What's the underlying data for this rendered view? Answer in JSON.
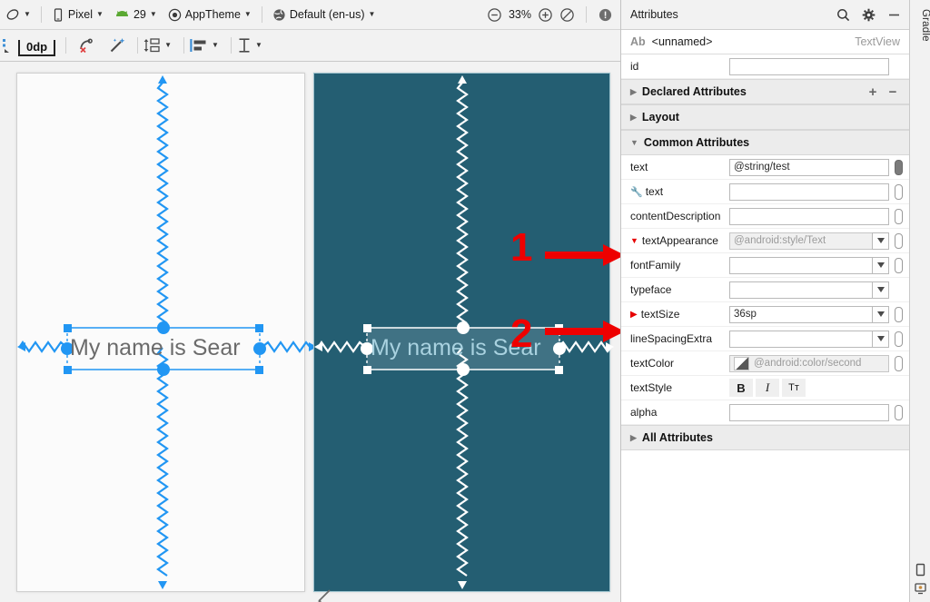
{
  "toolbar_main": {
    "items": [
      {
        "name": "design-surface-mode",
        "icon": "rotate-device-icon",
        "label": "",
        "caret": true
      },
      {
        "name": "device-selector",
        "icon": "phone-icon",
        "label": "Pixel",
        "caret": true
      },
      {
        "name": "api-level-selector",
        "icon": "android-api-icon",
        "label": "29",
        "caret": true
      },
      {
        "name": "theme-selector",
        "icon": "theme-circle-icon",
        "label": "AppTheme",
        "caret": true
      },
      {
        "name": "locale-selector",
        "icon": "globe-icon",
        "label": "Default (en-us)",
        "caret": true
      }
    ],
    "zoom": {
      "zoom_out_label": "⊖",
      "zoom_level": "33%",
      "zoom_in_label": "⊕",
      "zoom_fit_label": "⊘"
    },
    "warnings_icon": "warning-exclamation-icon"
  },
  "toolbar_constraints": {
    "margin_value": "0dp",
    "buttons": [
      {
        "name": "clear-constraints-button",
        "icon": "clear-constraints-icon"
      },
      {
        "name": "infer-constraints-button",
        "icon": "magic-wand-icon"
      },
      {
        "name": "pack-button",
        "icon": "pack-icon",
        "caret": true
      },
      {
        "name": "align-button",
        "icon": "align-icon",
        "caret": true
      },
      {
        "name": "guideline-button",
        "icon": "guideline-icon",
        "caret": true
      }
    ]
  },
  "canvas": {
    "devices": [
      {
        "name": "device-preview-light",
        "theme": "light",
        "background": "#fbfbfb",
        "widget_text": "My name is Sear"
      },
      {
        "name": "device-preview-dark",
        "theme": "dark",
        "background": "#245e72",
        "widget_text": "My name is Sear"
      }
    ],
    "annotations": [
      {
        "name": "annotation-1",
        "label": "1",
        "color": "#ee0000",
        "points_to": "textAppearance"
      },
      {
        "name": "annotation-2",
        "label": "2",
        "color": "#ee0000",
        "points_to": "textSize"
      }
    ],
    "edit_icon": "pencil-edit-icon"
  },
  "attributes_panel": {
    "title": "Attributes",
    "header_buttons": [
      {
        "name": "search-icon",
        "glyph": "search"
      },
      {
        "name": "gear-icon",
        "glyph": "gear"
      },
      {
        "name": "minimize-icon",
        "glyph": "minus"
      }
    ],
    "component": {
      "ab_mark": "Ab",
      "name": "<unnamed>",
      "type": "TextView"
    },
    "id_row": {
      "label": "id",
      "value": "",
      "placeholder": ""
    },
    "sections": [
      {
        "name": "declared-attributes-section",
        "label": "Declared Attributes",
        "expanded": false,
        "add": "+",
        "remove": "−"
      },
      {
        "name": "layout-section",
        "label": "Layout",
        "expanded": false
      },
      {
        "name": "common-attributes-section",
        "label": "Common Attributes",
        "expanded": true
      }
    ],
    "common_attributes": [
      {
        "name": "text",
        "label": "text",
        "value": "@string/test",
        "kind": "text",
        "pill": "filled",
        "disabled": false,
        "wrench": false,
        "marker": ""
      },
      {
        "name": "text-resolved",
        "label": "text",
        "value": "",
        "kind": "text",
        "pill": "empty",
        "disabled": false,
        "wrench": true,
        "marker": ""
      },
      {
        "name": "contentDescription",
        "label": "contentDescription",
        "value": "",
        "kind": "text",
        "pill": "empty",
        "disabled": false,
        "wrench": false,
        "marker": ""
      },
      {
        "name": "textAppearance",
        "label": "textAppearance",
        "value": "@android:style/Text",
        "kind": "combo",
        "pill": "empty",
        "disabled": true,
        "wrench": false,
        "marker": "red-expand"
      },
      {
        "name": "fontFamily",
        "label": "fontFamily",
        "value": "",
        "kind": "combo",
        "pill": "empty",
        "disabled": false,
        "wrench": false,
        "marker": ""
      },
      {
        "name": "typeface",
        "label": "typeface",
        "value": "",
        "kind": "combo",
        "pill": "hidden",
        "disabled": false,
        "wrench": false,
        "marker": ""
      },
      {
        "name": "textSize",
        "label": "textSize",
        "value": "36sp",
        "kind": "combo",
        "pill": "empty",
        "disabled": false,
        "wrench": false,
        "marker": "red"
      },
      {
        "name": "lineSpacingExtra",
        "label": "lineSpacingExtra",
        "value": "",
        "kind": "combo",
        "pill": "empty",
        "disabled": false,
        "wrench": false,
        "marker": ""
      },
      {
        "name": "textColor",
        "label": "textColor",
        "value": "@android:color/second",
        "kind": "color",
        "pill": "empty",
        "disabled": true,
        "wrench": false,
        "marker": ""
      },
      {
        "name": "textStyle",
        "label": "textStyle",
        "value": "",
        "kind": "style",
        "pill": "hidden",
        "disabled": false,
        "wrench": false,
        "marker": ""
      },
      {
        "name": "alpha",
        "label": "alpha",
        "value": "",
        "kind": "text",
        "pill": "empty",
        "disabled": false,
        "wrench": false,
        "marker": ""
      }
    ],
    "text_style_buttons": [
      {
        "name": "bold-button",
        "label": "B"
      },
      {
        "name": "italic-button",
        "label": "I"
      },
      {
        "name": "all-caps-button",
        "label": "Tт"
      }
    ],
    "all_attributes_section": {
      "name": "all-attributes-section",
      "label": "All Attributes",
      "expanded": false
    }
  },
  "side_strip": {
    "tabs": [
      {
        "name": "gradle-tool-tab",
        "label": "Gradle"
      }
    ],
    "bottom_icons": [
      {
        "name": "device-file-explorer-icon"
      },
      {
        "name": "emulator-icon"
      }
    ]
  }
}
